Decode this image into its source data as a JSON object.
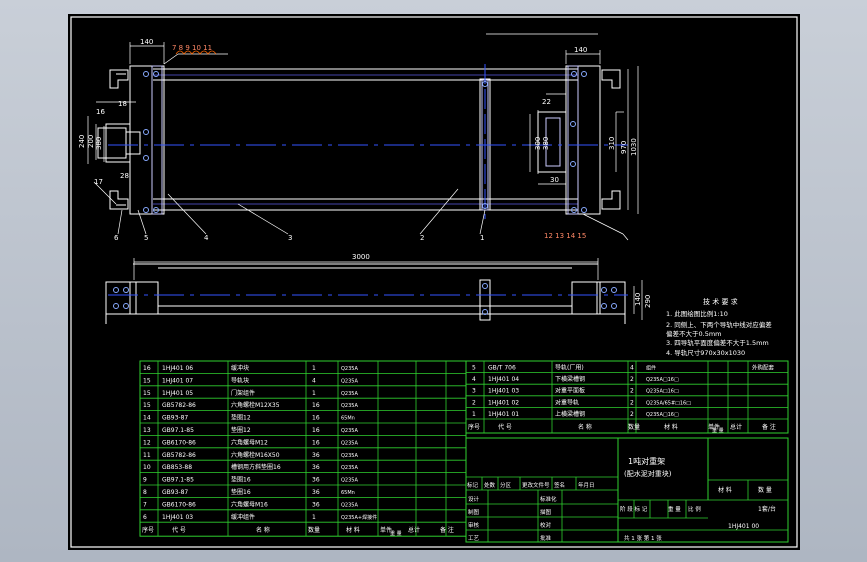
{
  "drawing": {
    "top_view": {
      "dims": {
        "top_left": "140",
        "callouts_top": "7 8 9 10 11",
        "top_right": "140",
        "left_18": "18",
        "left_16": "16",
        "left_240": "240",
        "left_200": "200",
        "left_380": "380",
        "left_28": "28",
        "left_17": "17",
        "mid_22": "22",
        "mid_300": "300",
        "mid_380": "380",
        "mid_30": "30",
        "right_310": "310",
        "right_970": "970",
        "right_1030": "1030",
        "bottom_6": "6",
        "bottom_5": "5",
        "bottom_4": "4",
        "bottom_3": "3",
        "bottom_2": "2",
        "bottom_1": "1",
        "callouts_right": "12 13 14 15"
      }
    },
    "front_view": {
      "dims": {
        "length": "3000",
        "d140": "140",
        "d290": "290"
      }
    },
    "technical_requirements": {
      "title": "技 术 要 求",
      "lines": [
        "1. 此图绘图比例1:10",
        "2. 同侧上、下两个导轨中线对应偏差",
        "   偏差不大于0.5mm",
        "3. 四导轨平面度偏差不大于1.5mm",
        "4. 导轨尺寸970x30x1030"
      ]
    },
    "bom_left": {
      "rows": [
        [
          "16",
          "1HJ401 06",
          "缓冲块",
          "1",
          "Q235A",
          "",
          "",
          ""
        ],
        [
          "15",
          "1HJ401 07",
          "导轨块",
          "4",
          "Q235A",
          "",
          "",
          ""
        ],
        [
          "15",
          "1HJ401 05",
          "门架组件",
          "1",
          "Q235A",
          "",
          "",
          ""
        ],
        [
          "15",
          "GB5782-86",
          "六角螺栓M12X35",
          "16",
          "Q235A",
          "",
          "",
          ""
        ],
        [
          "14",
          "GB93-87",
          "垫圈12",
          "16",
          "65Mn",
          "",
          "",
          ""
        ],
        [
          "13",
          "GB97.1-85",
          "垫圈12",
          "16",
          "Q235A",
          "",
          "",
          ""
        ],
        [
          "12",
          "GB6170-86",
          "六角螺母M12",
          "16",
          "Q235A",
          "",
          "",
          ""
        ],
        [
          "11",
          "GB5782-86",
          "六角螺栓M16X50",
          "36",
          "Q235A",
          "",
          "",
          ""
        ],
        [
          "10",
          "GB853-88",
          "槽钢用方斜垫圈16",
          "36",
          "Q235A",
          "",
          "",
          ""
        ],
        [
          "9",
          "GB97.1-85",
          "垫圈16",
          "36",
          "Q235A",
          "",
          "",
          ""
        ],
        [
          "8",
          "GB93-87",
          "垫圈16",
          "36",
          "65Mn",
          "",
          "",
          ""
        ],
        [
          "7",
          "GB6170-86",
          "六角螺母M16",
          "36",
          "Q235A",
          "",
          "",
          ""
        ],
        [
          "6",
          "1HJ401 03",
          "缓冲组件",
          "1",
          "Q235A+焊接件",
          "",
          "",
          ""
        ]
      ],
      "header": [
        "序号",
        "代 号",
        "名 称",
        "数量",
        "材 料",
        "单件",
        "总计",
        "备 注"
      ],
      "mass_label": "重 量"
    },
    "bom_right": {
      "rows": [
        [
          "5",
          "GB/T 706",
          "导轨(厂用)",
          "4",
          "组件",
          "",
          "外购配套"
        ],
        [
          "4",
          "1HJ401 04",
          "下横梁槽钢",
          "2",
          "Q235A□16□",
          "",
          ""
        ],
        [
          "3",
          "1HJ401 03",
          "对重平面板",
          "2",
          "Q235A□16□",
          "",
          ""
        ],
        [
          "2",
          "1HJ401 02",
          "对重导轨",
          "2",
          "Q235A/65#□16□",
          "",
          ""
        ],
        [
          "1",
          "1HJ401 01",
          "上横梁槽钢",
          "2",
          "Q235A□16□",
          "",
          ""
        ]
      ],
      "header": [
        "序号",
        "代 号",
        "名 称",
        "数量",
        "材 料",
        "单件",
        "总计",
        "备 注"
      ],
      "mass_label": "重 量"
    },
    "title_block": {
      "name_line1": "1吨对重架",
      "name_line2": "(配水泥对重块)",
      "material_label": "材 料",
      "qty_label": "数 量",
      "qty_value": "1套/台",
      "drawing_no": "1HJ401 00",
      "rev_headers": [
        "标记",
        "处数",
        "分区",
        "更改文件号",
        "签名",
        "年月日"
      ],
      "roles": [
        "设计",
        "制图",
        "审核",
        "工艺"
      ],
      "roles2": [
        "标准化",
        "描图",
        "校对",
        "批准"
      ],
      "stage_headers": [
        "阶 段 标 记",
        "重 量",
        "比 例"
      ],
      "sheets": "共 1 张    第 1 张"
    }
  }
}
